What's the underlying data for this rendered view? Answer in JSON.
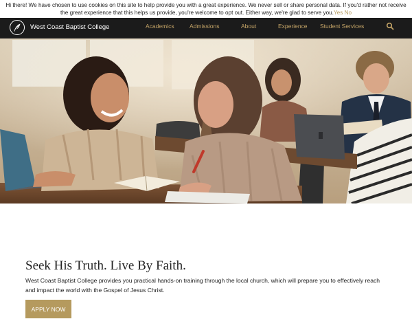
{
  "cookie_banner": {
    "message": "Hi there! We have chosen to use cookies on this site to help provide you with a great experience. We never sell or share personal data. If you'd rather not receive the great experience that this helps us provide, you're welcome to opt out. Either way, we're glad to serve you.",
    "yes_label": "Yes",
    "no_label": "No"
  },
  "nav": {
    "brand": "West Coast Baptist College",
    "items": [
      "Academics",
      "Admissions",
      "About",
      "Experience",
      "Student Services"
    ],
    "search_icon": "search-icon",
    "logo_icon": "feather-quill-icon"
  },
  "hero": {
    "image_icon": "students-studying-photo"
  },
  "intro": {
    "headline": "Seek His Truth. Live By Faith.",
    "body": "West Coast Baptist College provides you practical hands-on training through the local church, which will prepare you to effectively reach and impact the world with the Gospel of Jesus Christ.",
    "cta_label": "APPLY NOW"
  },
  "colors": {
    "accent": "#b59a5e",
    "nav_bg": "#1b1b1b",
    "nav_text": "#c4a467"
  }
}
